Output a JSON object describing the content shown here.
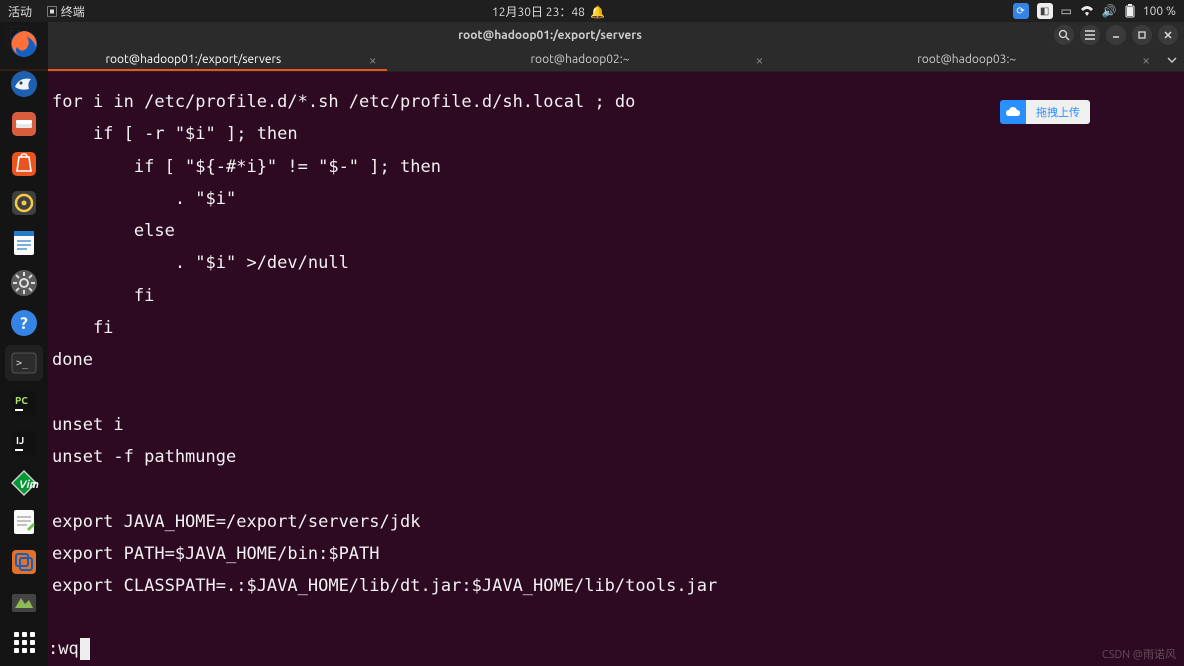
{
  "topbar": {
    "activities": "活动",
    "app_indicator": "终端",
    "datetime": "12月30日 23：48",
    "battery": "100 %"
  },
  "winbar": {
    "title": "root@hadoop01:/export/servers"
  },
  "tabs": [
    {
      "label": "root@hadoop01:/export/servers",
      "active": true
    },
    {
      "label": "root@hadoop02:~",
      "active": false
    },
    {
      "label": "root@hadoop03:~",
      "active": false
    }
  ],
  "upload": {
    "label": "拖拽上传"
  },
  "vim_command": ":wq",
  "file_content": "for i in /etc/profile.d/*.sh /etc/profile.d/sh.local ; do\n    if [ -r \"$i\" ]; then\n        if [ \"${-#*i}\" != \"$-\" ]; then\n            . \"$i\"\n        else\n            . \"$i\" >/dev/null\n        fi\n    fi\ndone\n\nunset i\nunset -f pathmunge\n\nexport JAVA_HOME=/export/servers/jdk\nexport PATH=$JAVA_HOME/bin:$PATH\nexport CLASSPATH=.:$JAVA_HOME/lib/dt.jar:$JAVA_HOME/lib/tools.jar",
  "watermark": "CSDN @雨诺风"
}
